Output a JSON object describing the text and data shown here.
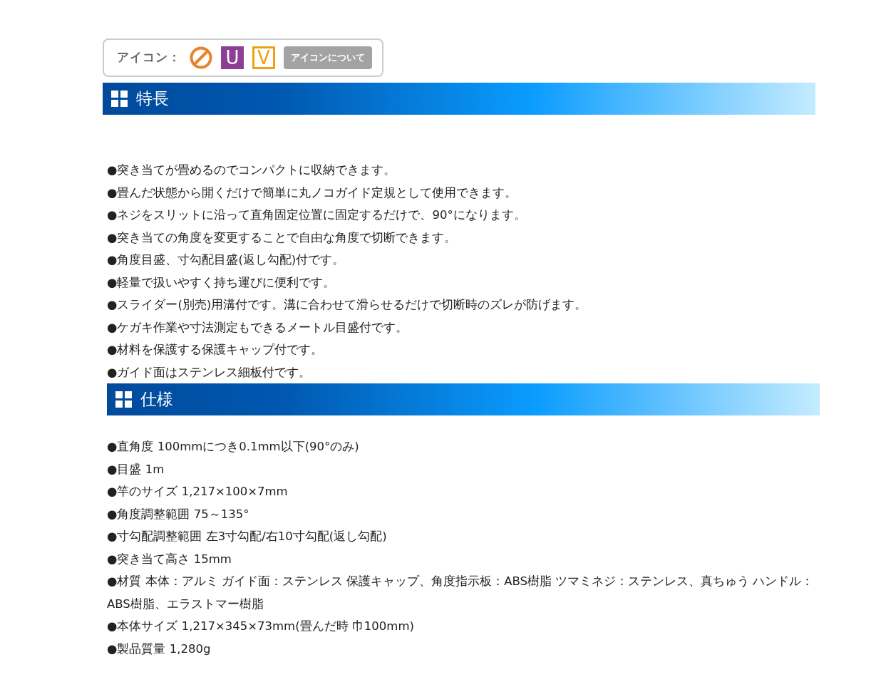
{
  "icon_bar": {
    "label": "アイコン：",
    "icons": [
      {
        "kind": "prohibited"
      },
      {
        "kind": "filled",
        "text": "U"
      },
      {
        "kind": "outlined",
        "text": "V"
      }
    ],
    "button": "アイコンについて"
  },
  "sections": [
    {
      "title": "特長",
      "items": [
        "●突き当てが畳めるのでコンパクトに収納できます。",
        "●畳んだ状態から開くだけで簡単に丸ノコガイド定規として使用できます。",
        "●ネジをスリットに沿って直角固定位置に固定するだけで、90°になります。",
        "●突き当ての角度を変更することで自由な角度で切断できます。",
        "●角度目盛、寸勾配目盛(返し勾配)付です。",
        "●軽量で扱いやすく持ち運びに便利です。",
        "●スライダー(別売)用溝付です。溝に合わせて滑らせるだけで切断時のズレが防げます。",
        "●ケガキ作業や寸法測定もできるメートル目盛付です。",
        "●材料を保護する保護キャップ付です。",
        "●ガイド面はステンレス細板付です。"
      ]
    },
    {
      "title": "仕様",
      "items": [
        "●直角度 100mmにつき0.1mm以下(90°のみ)",
        "●目盛 1m",
        "●竿のサイズ 1,217×100×7mm",
        "●角度調整範囲 75～135°",
        "●寸勾配調整範囲 左3寸勾配/右10寸勾配(返し勾配)",
        "●突き当て高さ 15mm",
        "●材質 本体：アルミ ガイド面：ステンレス 保護キャップ、角度指示板：ABS樹脂 ツマミネジ：ステンレス、真ちゅう ハンドル：ABS樹脂、エラストマー樹脂",
        "●本体サイズ 1,217×345×73mm(畳んだ時 巾100mm)",
        "●製品質量 1,280g"
      ]
    }
  ]
}
